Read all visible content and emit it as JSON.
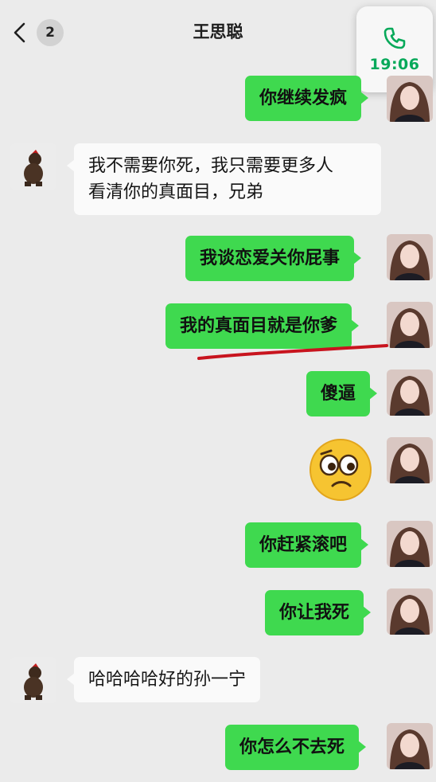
{
  "header": {
    "back_icon": "chevron-left-icon",
    "unread_count": "2",
    "contact_name": "王思聪"
  },
  "call_widget": {
    "icon": "phone-icon",
    "duration": "19:06",
    "accent_color": "#07a95a"
  },
  "messages": [
    {
      "side": "out",
      "text": "你继续发疯"
    },
    {
      "side": "in",
      "lines": [
        "我不需要你死，我只需要更多人",
        "看清你的真面目，兄弟"
      ]
    },
    {
      "side": "out",
      "text": "我谈恋爱关你屁事"
    },
    {
      "side": "out",
      "text": "我的真面目就是你爹",
      "annotation": "red-underline"
    },
    {
      "side": "out",
      "text": "傻逼"
    },
    {
      "side": "out",
      "type": "emoji",
      "emoji": "worried-face-icon"
    },
    {
      "side": "out",
      "text": "你赶紧滚吧"
    },
    {
      "side": "out",
      "text": "你让我死"
    },
    {
      "side": "in",
      "text": "哈哈哈哈好的孙一宁"
    },
    {
      "side": "out",
      "text": "你怎么不去死"
    }
  ],
  "colors": {
    "outgoing_bubble": "#3fd94f",
    "incoming_bubble": "#fafafa",
    "background": "#ebebeb",
    "annotation": "#c8141e"
  }
}
